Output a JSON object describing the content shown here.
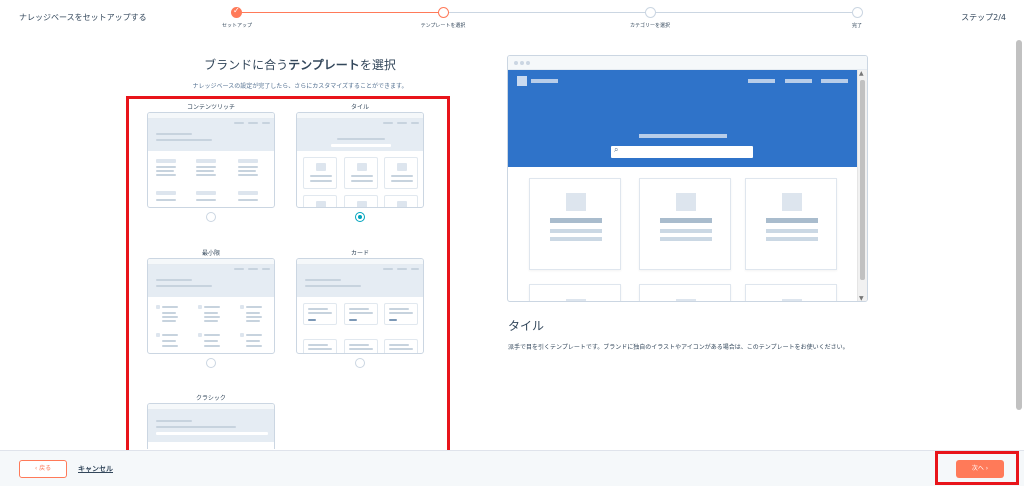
{
  "header": {
    "title": "ナレッジベースをセットアップする",
    "step_counter": "ステップ2/4",
    "steps": [
      {
        "label": "セットアップ",
        "state": "done"
      },
      {
        "label": "テンプレートを選択",
        "state": "current"
      },
      {
        "label": "カテゴリーを選択",
        "state": "todo"
      },
      {
        "label": "完了",
        "state": "todo"
      }
    ]
  },
  "main": {
    "heading_prefix": "ブランドに合う",
    "heading_bold": "テンプレート",
    "heading_suffix": "を選択",
    "subheading": "ナレッジベースの設定が完了したら、さらにカスタマイズすることができます。",
    "templates": [
      {
        "label": "コンテンツリッチ",
        "selected": false
      },
      {
        "label": "タイル",
        "selected": true
      },
      {
        "label": "最小限",
        "selected": false
      },
      {
        "label": "カード",
        "selected": false
      },
      {
        "label": "クラシック",
        "selected": false
      }
    ]
  },
  "preview": {
    "name": "タイル",
    "description": "派手で目を引くテンプレートです。ブランドに独自のイラストやアイコンがある場合は、このテンプレートをお使いください。",
    "hero_color": "#2f73c9"
  },
  "footer": {
    "back_label": "‹ 戻る",
    "cancel_label": "キャンセル",
    "next_label": "次へ ›"
  },
  "colors": {
    "accent": "#ff7a59",
    "radio_selected": "#00a4bd",
    "highlight": "#e8141a"
  }
}
